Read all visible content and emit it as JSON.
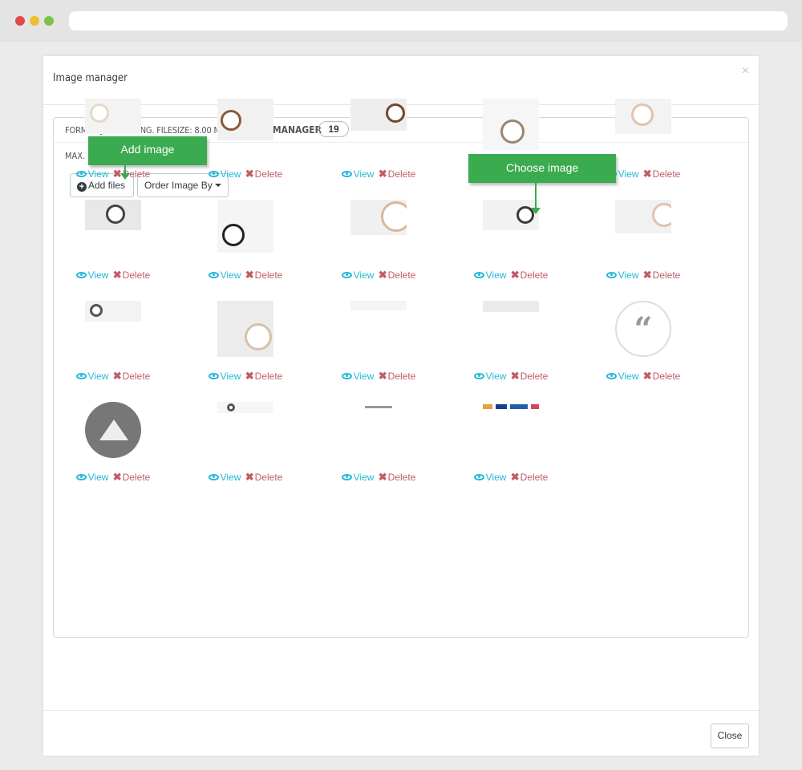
{
  "modal": {
    "title": "Image manager",
    "close_icon": "×"
  },
  "panel": {
    "format_text": "FORMAT: JPG, GIF, PNG. FILESIZE: 8.00 MB",
    "manager_label": "IMAGES MANAGER",
    "count": "19",
    "max_text": "MAX."
  },
  "toolbar": {
    "add_files_label": "Add files",
    "order_label": "Order Image By"
  },
  "callouts": {
    "add_image": "Add image",
    "choose_image": "Choose image"
  },
  "images": [
    {
      "thumb": "watch-banner-white",
      "view": "View",
      "delete": "Delete"
    },
    {
      "thumb": "kobold-expedition-leather",
      "view": "View",
      "delete": "Delete"
    },
    {
      "thumb": "kobold-expedition-leather-2",
      "view": "View",
      "delete": "Delete"
    },
    {
      "thumb": "new-kobold-watch",
      "view": "View",
      "delete": "Delete"
    },
    {
      "thumb": "watch-rose-strap",
      "view": "View",
      "delete": "Delete"
    },
    {
      "thumb": "watch-on-wrist",
      "view": "View",
      "delete": "Delete"
    },
    {
      "thumb": "kobold-expedition-watches-black",
      "view": "View",
      "delete": "Delete"
    },
    {
      "thumb": "leather-watches",
      "view": "View",
      "delete": "Delete"
    },
    {
      "thumb": "kobold-himalaya-dark",
      "view": "View",
      "delete": "Delete"
    },
    {
      "thumb": "horse-creative-show",
      "view": "View",
      "delete": "Delete"
    },
    {
      "thumb": "watch-strip-banner",
      "view": "View",
      "delete": "Delete"
    },
    {
      "thumb": "kobold-hymalaya",
      "view": "View",
      "delete": "Delete"
    },
    {
      "thumb": "blank-banner-1",
      "view": "View",
      "delete": "Delete"
    },
    {
      "thumb": "blank-banner-2",
      "view": "View",
      "delete": "Delete"
    },
    {
      "thumb": "quote-circle",
      "view": "View",
      "delete": "Delete"
    },
    {
      "thumb": "mountain-logo",
      "view": "View",
      "delete": "Delete"
    },
    {
      "thumb": "watches-strip",
      "view": "View",
      "delete": "Delete"
    },
    {
      "thumb": "watch-store-logo",
      "view": "View",
      "delete": "Delete"
    },
    {
      "thumb": "payment-logos",
      "view": "View",
      "delete": "Delete"
    }
  ],
  "footer": {
    "close_label": "Close"
  }
}
